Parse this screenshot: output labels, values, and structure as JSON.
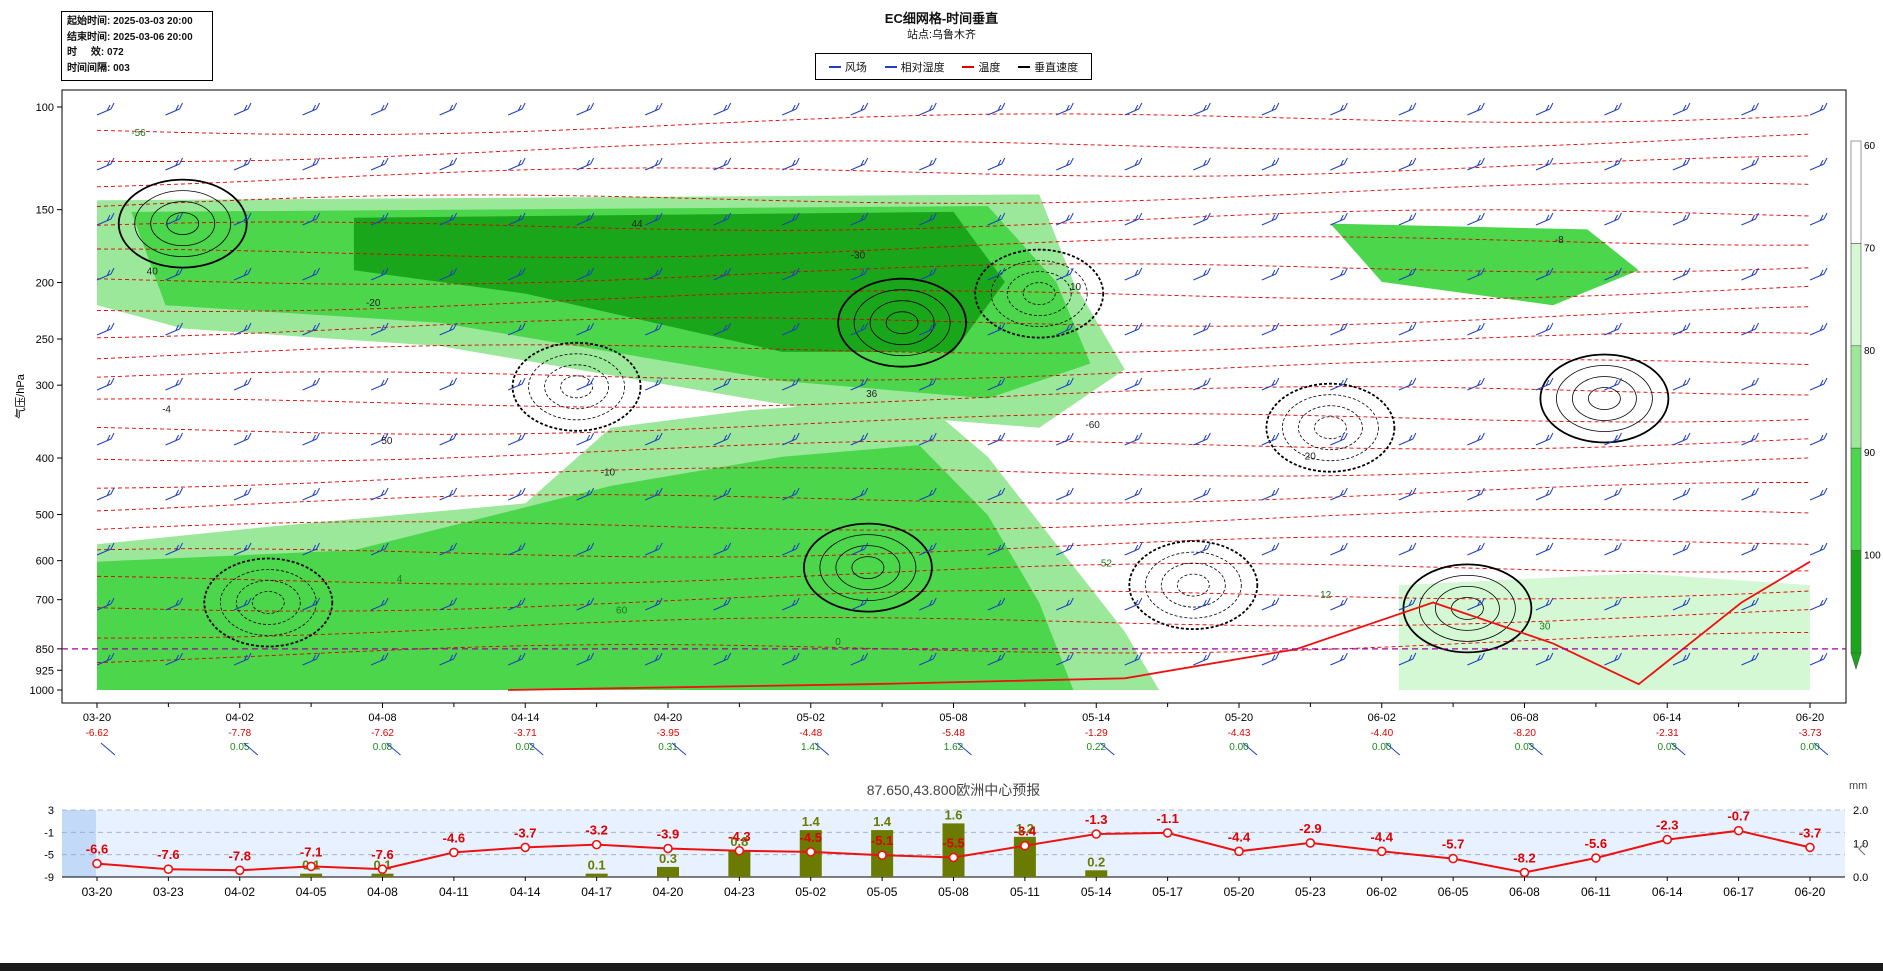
{
  "info": {
    "start_label": "起始时间:",
    "start_value": "2025-03-03 20:00",
    "end_label": "结束时间:",
    "end_value": "2025-03-06 20:00",
    "hours_label": "时     效:",
    "hours_value": "072",
    "interval_label": "时间间隔:",
    "interval_value": "003"
  },
  "title": "EC细网格-时间垂直",
  "subtitle": "站点:乌鲁木齐",
  "legend": [
    {
      "label": "风场",
      "color": "#1f3fbf",
      "style": "solid"
    },
    {
      "label": "相对湿度",
      "color": "#1f3fbf",
      "style": "solid"
    },
    {
      "label": "温度",
      "color": "#e00000",
      "style": "dashed"
    },
    {
      "label": "垂直速度",
      "color": "#000000",
      "style": "solid"
    }
  ],
  "colors": {
    "wind": "#1f3fbf",
    "temp": "#e00000",
    "omega": "#000000",
    "rh_dark": "#1aa61a",
    "rh_mid": "#4cd64c",
    "rh_light": "#9be89b",
    "rh_pale": "#d4f7d4",
    "level850": "#a000a0",
    "precip_bar": "#6b7a00",
    "min_temp_line": "#ee1111",
    "bottom_bg": "#e8f1ff",
    "bottom_highlight": "#c2d9f7"
  },
  "chart_data": [
    {
      "type": "heatmap",
      "title": "EC细网格-时间垂直",
      "subtitle": "站点:乌鲁木齐",
      "ylabel": "气压/hPa",
      "y_levels": [
        "100",
        "150",
        "200",
        "250",
        "300",
        "400",
        "500",
        "600",
        "700",
        "850",
        "925",
        "1000"
      ],
      "y_scale": "log-pressure",
      "ylim": [
        100,
        1000
      ],
      "x_ticks": [
        "03-20",
        "04-02",
        "04-08",
        "04-14",
        "04-20",
        "05-02",
        "05-08",
        "05-14",
        "05-20",
        "06-02",
        "06-08",
        "06-14",
        "06-20"
      ],
      "surface_temp": [
        "-6.62",
        "-7.78",
        "-7.62",
        "-3.71",
        "-3.95",
        "-4.48",
        "-5.48",
        "-1.29",
        "-4.43",
        "-4.40",
        "-8.20",
        "-2.31",
        "-3.73"
      ],
      "surface_precip": [
        "",
        "0.05",
        "0.08",
        "0.02",
        "0.31",
        "1.41",
        "1.62",
        "0.22",
        "0.00",
        "0.00",
        "0.03",
        "0.03",
        "0.00"
      ],
      "colorbar": {
        "ticks": [
          "60",
          "70",
          "80",
          "90",
          "100"
        ],
        "colors": [
          "#ffffff",
          "#d4f7d4",
          "#9be89b",
          "#4cd64c",
          "#1aa61a"
        ]
      },
      "reference_level": "850",
      "contour_labels": [
        "-56",
        "-20",
        "-10",
        "0",
        "10",
        "20",
        "30",
        "40",
        "50",
        "60",
        "-30",
        "-60",
        "12",
        "-8",
        "-4",
        "4",
        "44",
        "36",
        "52"
      ]
    },
    {
      "type": "bar",
      "title": "87.650,43.800欧洲中心预报",
      "y2label": "mm",
      "categories": [
        "03-20",
        "03-23",
        "04-02",
        "04-05",
        "04-08",
        "04-11",
        "04-14",
        "04-17",
        "04-20",
        "04-23",
        "05-02",
        "05-05",
        "05-08",
        "05-11",
        "05-14",
        "05-17",
        "05-20",
        "05-23",
        "06-02",
        "06-05",
        "06-08",
        "06-11",
        "06-14",
        "06-17",
        "06-20"
      ],
      "series": [
        {
          "values": [
            -6.6,
            -7.6,
            -7.8,
            -7.1,
            -7.6,
            -4.6,
            -3.7,
            -3.2,
            -3.9,
            -4.3,
            -4.5,
            -5.1,
            -5.5,
            -3.4,
            -1.3,
            -1.1,
            -4.4,
            -2.9,
            -4.4,
            -5.7,
            -8.2,
            -5.6,
            -2.3,
            -0.7,
            -3.7
          ],
          "axis": "left",
          "kind": "line"
        },
        {
          "values": [
            null,
            null,
            null,
            0.1,
            0.1,
            null,
            null,
            0.1,
            0.3,
            0.8,
            1.4,
            1.4,
            1.6,
            1.2,
            0.2,
            null,
            null,
            null,
            null,
            null,
            null,
            null,
            null,
            null,
            null
          ],
          "axis": "right",
          "kind": "bar"
        }
      ],
      "y_ticks": [
        "3",
        "-1",
        "-5",
        "-9"
      ],
      "ylim": [
        -9,
        3
      ],
      "y2_ticks": [
        "2.0",
        "1.0",
        "0.0"
      ],
      "y2lim": [
        0,
        2
      ]
    }
  ]
}
